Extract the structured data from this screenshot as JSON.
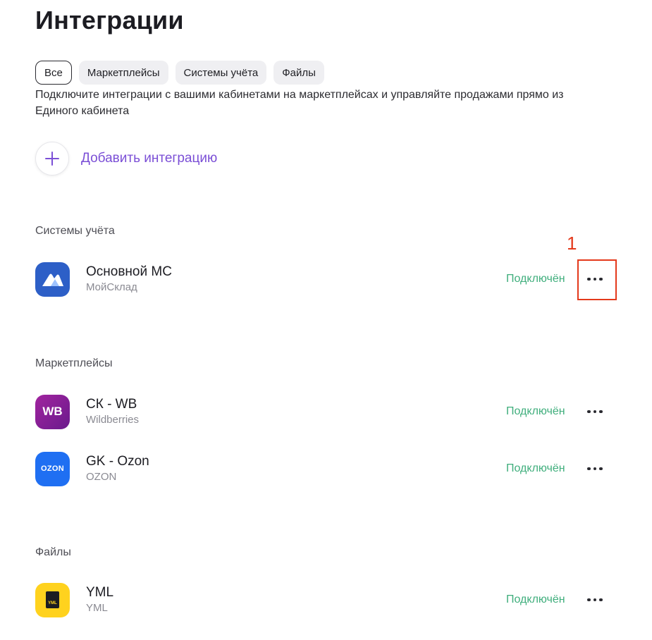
{
  "page_title": "Интеграции",
  "filters": [
    {
      "label": "Все",
      "active": true
    },
    {
      "label": "Маркетплейсы",
      "active": false
    },
    {
      "label": "Системы учёта",
      "active": false
    },
    {
      "label": "Файлы",
      "active": false
    }
  ],
  "intro": "Подключите интеграции с вашими кабинетами на маркетплейсах и управляйте продажами прямо из Единого кабинета",
  "add_integration": {
    "label": "Добавить интеграцию",
    "icon": "plus-icon"
  },
  "sections": {
    "accounting": {
      "title": "Системы учёта",
      "items": [
        {
          "name": "Основной МС",
          "provider": "МойСклад",
          "status": "Подключён",
          "logo_color": "#2d5fc7"
        }
      ]
    },
    "marketplaces": {
      "title": "Маркетплейсы",
      "items": [
        {
          "name": "СК - WB",
          "provider": "Wildberries",
          "status": "Подключён",
          "logo_text": "WB",
          "logo_color": "#8e1f9c"
        },
        {
          "name": "GK - Ozon",
          "provider": "OZON",
          "status": "Подключён",
          "logo_text": "OZON",
          "logo_color": "#1f6ff2"
        }
      ]
    },
    "files": {
      "title": "Файлы",
      "items": [
        {
          "name": "YML",
          "provider": "YML",
          "status": "Подключён",
          "logo_text": "YML",
          "logo_color": "#ffd21e"
        }
      ]
    }
  },
  "annotation": {
    "number": "1",
    "color": "#e4391b"
  },
  "colors": {
    "status": "#3fae7c",
    "accent": "#7b4fd6"
  }
}
